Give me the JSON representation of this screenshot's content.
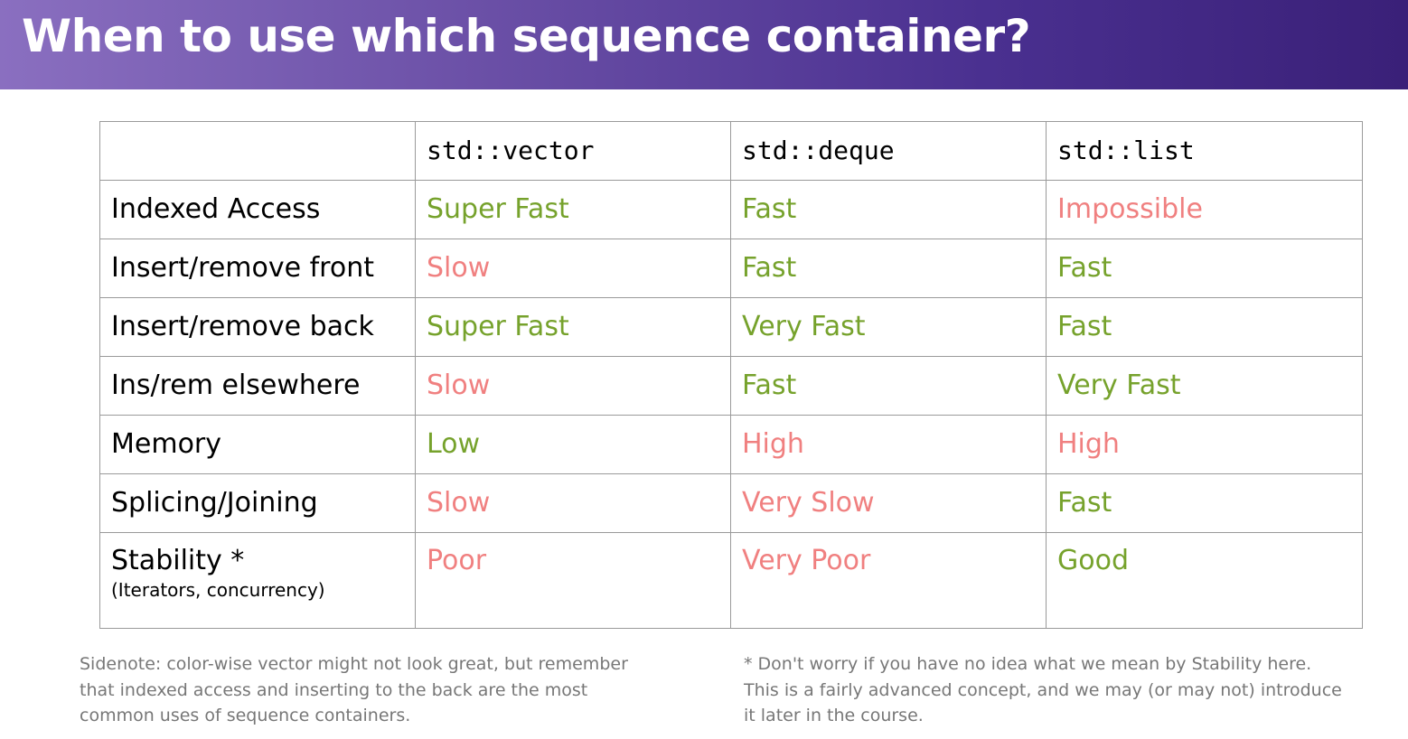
{
  "title": "When to use which sequence container?",
  "columns": [
    "",
    "std::vector",
    "std::deque",
    "std::list"
  ],
  "rows": [
    {
      "label": "Indexed Access",
      "cells": [
        {
          "text": "Super Fast",
          "rating": "good"
        },
        {
          "text": "Fast",
          "rating": "good"
        },
        {
          "text": "Impossible",
          "rating": "bad"
        }
      ]
    },
    {
      "label": "Insert/remove front",
      "cells": [
        {
          "text": "Slow",
          "rating": "bad"
        },
        {
          "text": "Fast",
          "rating": "good"
        },
        {
          "text": "Fast",
          "rating": "good"
        }
      ]
    },
    {
      "label": "Insert/remove back",
      "cells": [
        {
          "text": "Super Fast",
          "rating": "good"
        },
        {
          "text": "Very Fast",
          "rating": "good"
        },
        {
          "text": "Fast",
          "rating": "good"
        }
      ]
    },
    {
      "label": "Ins/rem elsewhere",
      "cells": [
        {
          "text": "Slow",
          "rating": "bad"
        },
        {
          "text": "Fast",
          "rating": "good"
        },
        {
          "text": "Very Fast",
          "rating": "good"
        }
      ]
    },
    {
      "label": "Memory",
      "cells": [
        {
          "text": "Low",
          "rating": "good"
        },
        {
          "text": "High",
          "rating": "bad"
        },
        {
          "text": "High",
          "rating": "bad"
        }
      ]
    },
    {
      "label": "Splicing/Joining",
      "cells": [
        {
          "text": "Slow",
          "rating": "bad"
        },
        {
          "text": "Very Slow",
          "rating": "bad"
        },
        {
          "text": "Fast",
          "rating": "good"
        }
      ]
    },
    {
      "label": "Stability *",
      "sublabel": "(Iterators, concurrency)",
      "cells": [
        {
          "text": "Poor",
          "rating": "bad"
        },
        {
          "text": "Very Poor",
          "rating": "bad"
        },
        {
          "text": "Good",
          "rating": "good"
        }
      ]
    }
  ],
  "colors": {
    "good": "#76a22c",
    "bad": "#f08080",
    "header_gradient_start": "#8a6fc0",
    "header_gradient_end": "#3a2078",
    "note_text": "#777777",
    "border": "#9a9a9a"
  },
  "notes": {
    "left": "Sidenote: color-wise vector might not look great, but remember that indexed access and inserting to the back are the most common uses of sequence containers.",
    "right": "* Don't worry if you have no idea what we mean by Stability here. This is a fairly advanced concept, and we may (or may not) introduce it later in the course."
  }
}
